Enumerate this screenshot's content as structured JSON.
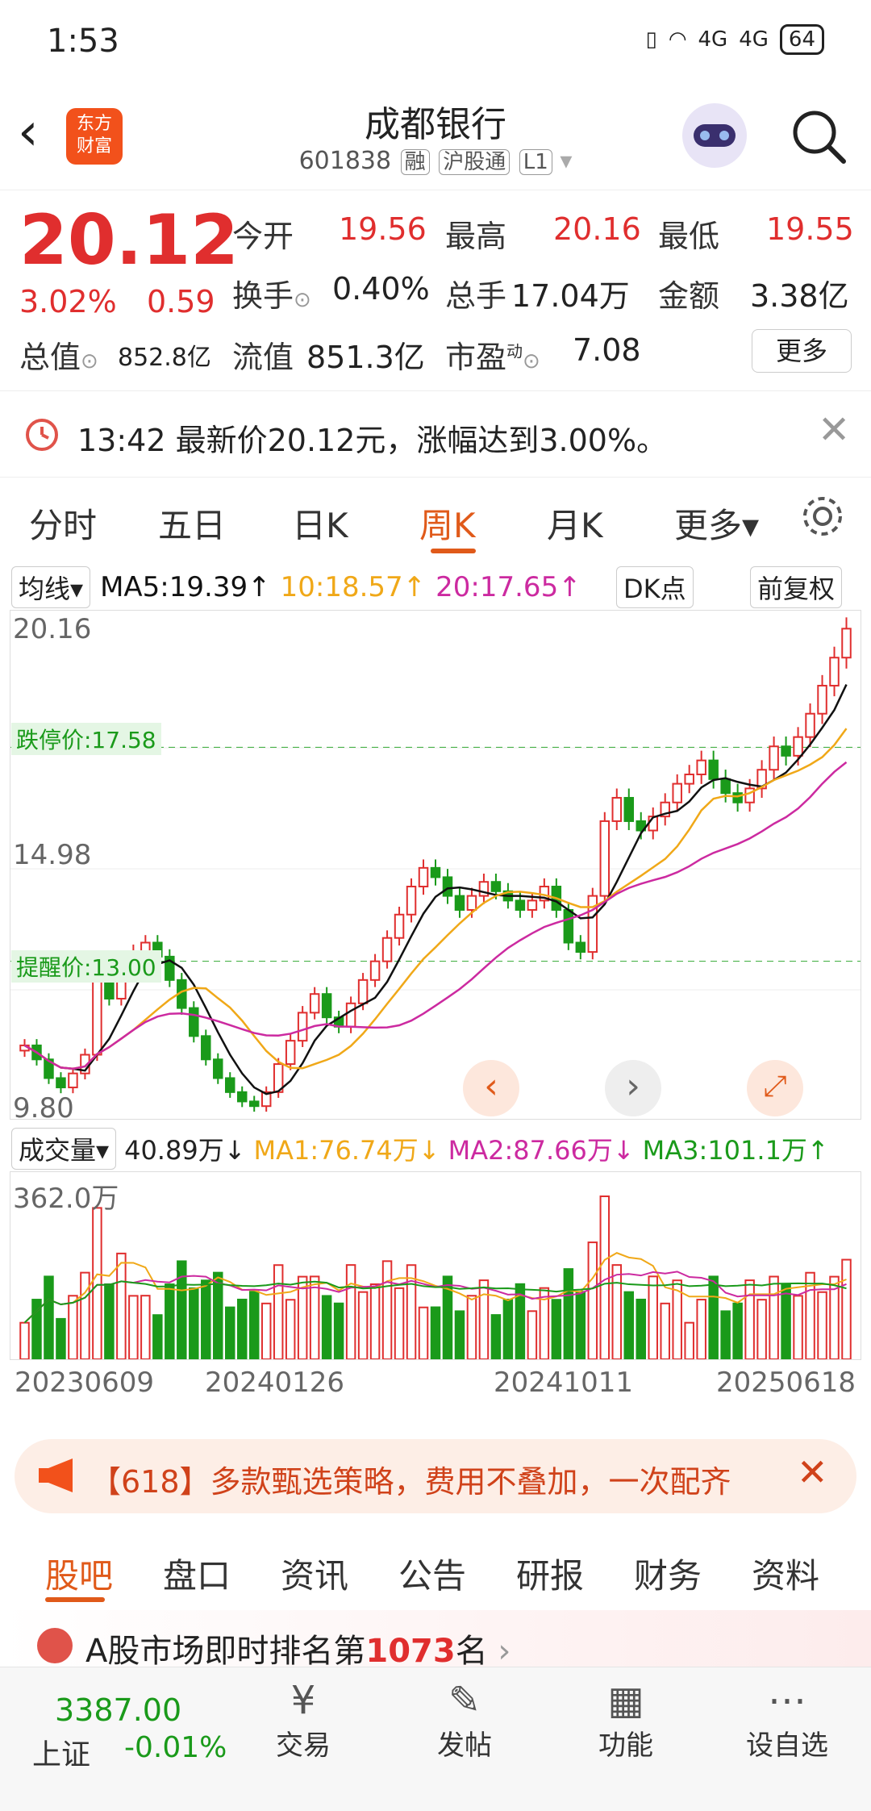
{
  "status_bar": {
    "time": "1:53",
    "signal1": "4G",
    "signal2": "4G",
    "battery": "64"
  },
  "header": {
    "title": "成都银行",
    "code": "601838",
    "tag_margin": "融",
    "tag_connect": "沪股通",
    "tag_level": "L1",
    "logo_line1": "东方",
    "logo_line2": "财富"
  },
  "quote": {
    "price": "20.12",
    "change_pct": "3.02%",
    "change_abs": "0.59",
    "open_label": "今开",
    "open": "19.56",
    "high_label": "最高",
    "high": "20.16",
    "low_label": "最低",
    "low": "19.55",
    "turnover_label": "换手",
    "turnover": "0.40%",
    "volume_label": "总手",
    "volume": "17.04万",
    "amount_label": "金额",
    "amount": "3.38亿",
    "mcap_label": "总值",
    "mcap": "852.8亿",
    "float_label": "流值",
    "float": "851.3亿",
    "pe_label": "市盈",
    "pe_sup": "动",
    "pe": "7.08",
    "more_label": "更多"
  },
  "alert": {
    "text": "13:42 最新价20.12元，涨幅达到3.00%。"
  },
  "kline_tabs": [
    "分时",
    "五日",
    "日K",
    "周K",
    "月K",
    "更多"
  ],
  "kline_active": "周K",
  "ma_legend": {
    "mode": "均线",
    "ma5": "MA5:19.39↑",
    "ma10": "10:18.57↑",
    "ma20": "20:17.65↑",
    "dk": "DK点",
    "adjust": "前复权"
  },
  "price_axis": {
    "top": "20.16",
    "limit_down": "跌停价:17.58",
    "mid": "14.98",
    "stop_profit": "提醒价:13.00",
    "bottom": "9.80"
  },
  "volume_legend": {
    "mode": "成交量",
    "vol": "40.89万↓",
    "ma1": "MA1:76.74万↓",
    "ma2": "MA2:87.66万↓",
    "ma3": "MA3:101.1万↑",
    "max": "362.0万"
  },
  "date_axis": [
    "20230609",
    "20240126",
    "20241011",
    "20250618"
  ],
  "banner": {
    "text": "【618】多款甄选策略，费用不叠加，一次配齐"
  },
  "bottom_tabs": [
    "股吧",
    "盘口",
    "资讯",
    "公告",
    "研报",
    "财务",
    "资料"
  ],
  "bottom_active": "股吧",
  "rank_text_prefix": "A股市场即时排名第",
  "rank_value": "1073",
  "rank_suffix": "名",
  "index": {
    "name": "上证",
    "value": "3387.00",
    "change": "-0.01%"
  },
  "nav": [
    "交易",
    "发帖",
    "功能",
    "设自选"
  ],
  "colors": {
    "up": "#e02e2e",
    "down": "#1a9a1a",
    "accent": "#e05a1a",
    "ma5": "#111111",
    "ma10": "#f0a818",
    "ma20": "#cc2aa0"
  },
  "chart_data": {
    "type": "candlestick",
    "y_range": [
      9.8,
      20.16
    ],
    "limit_down_price": 17.58,
    "alert_price": 13.0,
    "x_labels": [
      "20230609",
      "20240126",
      "20241011",
      "20250618"
    ],
    "closes": [
      11.2,
      10.9,
      10.5,
      10.3,
      10.6,
      11.0,
      12.6,
      12.2,
      12.8,
      13.2,
      13.4,
      13.1,
      12.6,
      12.0,
      11.4,
      10.9,
      10.5,
      10.2,
      10.0,
      9.9,
      10.2,
      10.8,
      11.3,
      11.9,
      12.3,
      11.8,
      11.6,
      12.1,
      12.6,
      13.0,
      13.5,
      14.0,
      14.6,
      15.0,
      14.8,
      14.4,
      14.1,
      14.4,
      14.7,
      14.5,
      14.3,
      14.1,
      14.3,
      14.6,
      14.1,
      13.4,
      13.2,
      14.4,
      16.0,
      16.5,
      16.0,
      15.8,
      16.1,
      16.4,
      16.8,
      17.0,
      17.3,
      16.9,
      16.6,
      16.4,
      16.7,
      17.1,
      17.6,
      17.4,
      17.8,
      18.3,
      18.9,
      19.5,
      20.12
    ]
  }
}
